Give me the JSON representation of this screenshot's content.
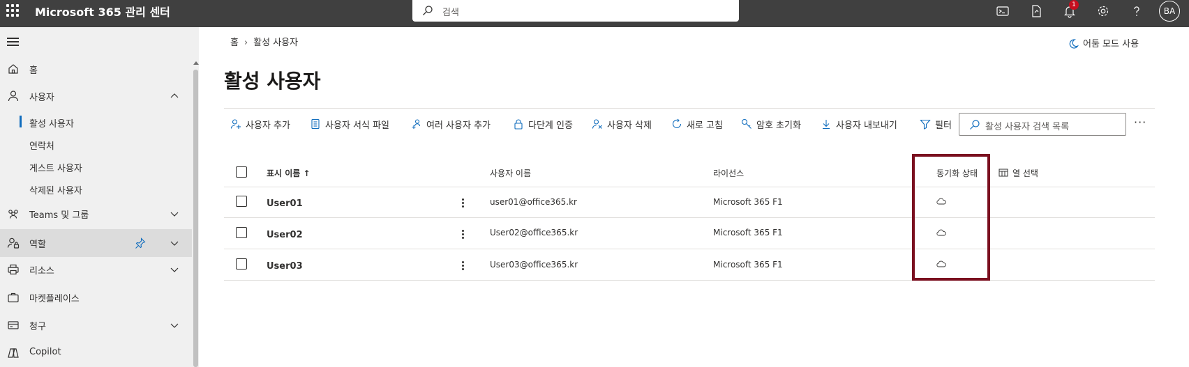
{
  "topbar": {
    "app_title": "Microsoft 365 관리 센터",
    "search_placeholder": "검색",
    "notification_count": "1",
    "avatar_initials": "BA"
  },
  "sidebar": {
    "items": [
      {
        "label": "홈",
        "icon": "home-icon"
      },
      {
        "label": "사용자",
        "icon": "person-icon",
        "expanded": true
      },
      {
        "label": "Teams 및 그룹",
        "icon": "group-icon"
      },
      {
        "label": "역할",
        "icon": "role-icon"
      },
      {
        "label": "리소스",
        "icon": "printer-icon"
      },
      {
        "label": "마켓플레이스",
        "icon": "briefcase-icon"
      },
      {
        "label": "청구",
        "icon": "billing-icon"
      },
      {
        "label": "Copilot",
        "icon": "copilot-icon"
      }
    ],
    "user_subitems": [
      {
        "label": "활성 사용자",
        "selected": true
      },
      {
        "label": "연락처"
      },
      {
        "label": "게스트 사용자"
      },
      {
        "label": "삭제된 사용자"
      }
    ]
  },
  "breadcrumb": {
    "home": "홈",
    "current": "활성 사용자"
  },
  "dark_mode_label": "어둠 모드 사용",
  "page_title": "활성 사용자",
  "toolbar": {
    "add_user": "사용자 추가",
    "user_template": "사용자 서식 파일",
    "add_multiple": "여러 사용자 추가",
    "mfa": "다단계 인증",
    "delete_user": "사용자 삭제",
    "refresh": "새로 고침",
    "reset_password": "암호 초기화",
    "export_users": "사용자 내보내기",
    "filter": "필터",
    "search_placeholder": "활성 사용자 검색 목록",
    "more": "···"
  },
  "table": {
    "headers": {
      "display_name": "표시 이름 ↑",
      "username": "사용자 이름",
      "license": "라이선스",
      "sync_status": "동기화 상태",
      "choose_columns": "열 선택"
    },
    "rows": [
      {
        "display_name": "User01",
        "username": "user01@office365.kr",
        "license": "Microsoft 365 F1",
        "sync_status": "cloud-icon"
      },
      {
        "display_name": "User02",
        "username": "User02@office365.kr",
        "license": "Microsoft 365 F1",
        "sync_status": "cloud-icon"
      },
      {
        "display_name": "User03",
        "username": "User03@office365.kr",
        "license": "Microsoft 365 F1",
        "sync_status": "cloud-icon"
      }
    ]
  },
  "colors": {
    "topbar": "#404040",
    "sidebar": "#f0f0f0",
    "highlight_border": "#7a0f1f",
    "accent": "#0f6cbd"
  }
}
